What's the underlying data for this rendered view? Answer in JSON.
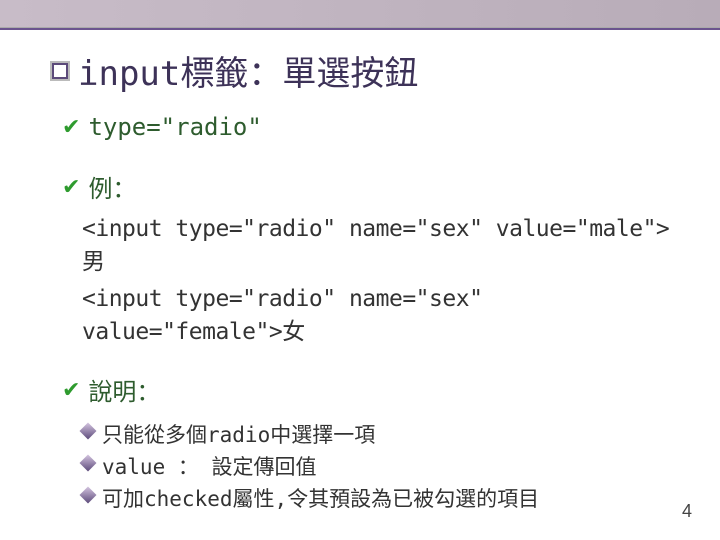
{
  "title": "input標籤：單選按鈕",
  "bullets": [
    {
      "text": "type=\"radio\""
    },
    {
      "text": "例："
    }
  ],
  "code_lines": [
    "<input type=\"radio\" name=\"sex\" value=\"male\">男",
    "<input type=\"radio\" name=\"sex\" value=\"female\">女"
  ],
  "explanation_label": "說明：",
  "explanations": [
    "只能從多個radio中選擇一項",
    "value ： 設定傳回值",
    "可加checked屬性,令其預設為已被勾選的項目"
  ],
  "page_number": "4"
}
